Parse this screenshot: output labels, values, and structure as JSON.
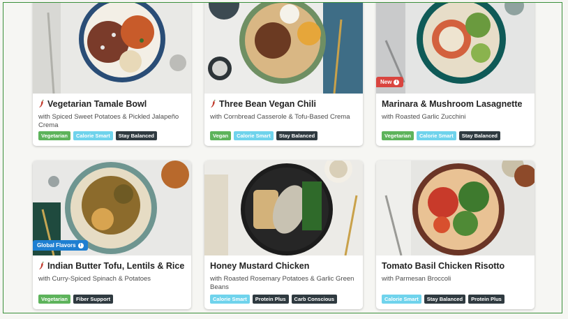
{
  "cards": [
    {
      "title": "Vegetarian Tamale Bowl",
      "subtitle": "with Spiced Sweet Potatoes & Pickled Jalapeño Crema",
      "spicy": true,
      "tags": [
        {
          "label": "Vegetarian",
          "kind": "veg"
        },
        {
          "label": "Calorie Smart",
          "kind": "cal"
        },
        {
          "label": "Stay Balanced",
          "kind": "dark"
        }
      ]
    },
    {
      "title": "Three Bean Vegan Chili",
      "subtitle": "with Cornbread Casserole & Tofu-Based Crema",
      "spicy": true,
      "tags": [
        {
          "label": "Vegan",
          "kind": "veg"
        },
        {
          "label": "Calorie Smart",
          "kind": "cal"
        },
        {
          "label": "Stay Balanced",
          "kind": "dark"
        }
      ]
    },
    {
      "title": "Marinara & Mushroom Lasagnette",
      "subtitle": "with Roasted Garlic Zucchini",
      "spicy": false,
      "badge": {
        "label": "New",
        "color": "#d9453f"
      },
      "tags": [
        {
          "label": "Vegetarian",
          "kind": "veg"
        },
        {
          "label": "Calorie Smart",
          "kind": "cal"
        },
        {
          "label": "Stay Balanced",
          "kind": "dark"
        }
      ]
    },
    {
      "title": "Indian Butter Tofu, Lentils & Rice",
      "subtitle": "with Curry-Spiced Spinach & Potatoes",
      "spicy": true,
      "badge": {
        "label": "Global Flavors",
        "color": "#1e7fd1"
      },
      "tags": [
        {
          "label": "Vegetarian",
          "kind": "veg"
        },
        {
          "label": "Fiber Support",
          "kind": "dark"
        }
      ]
    },
    {
      "title": "Honey Mustard Chicken",
      "subtitle": "with Roasted Rosemary Potatoes & Garlic Green Beans",
      "spicy": false,
      "tags": [
        {
          "label": "Calorie Smart",
          "kind": "cal"
        },
        {
          "label": "Protein Plus",
          "kind": "dark"
        },
        {
          "label": "Carb Conscious",
          "kind": "dark"
        }
      ]
    },
    {
      "title": "Tomato Basil Chicken Risotto",
      "subtitle": "with Parmesan Broccoli",
      "spicy": false,
      "tags": [
        {
          "label": "Calorie Smart",
          "kind": "cal"
        },
        {
          "label": "Stay Balanced",
          "kind": "dark"
        },
        {
          "label": "Protein Plus",
          "kind": "dark"
        }
      ]
    }
  ],
  "icons": {
    "spicy": "chili-pepper-icon",
    "badge_info": "info-icon"
  },
  "colors": {
    "vegetarian_tag": "#5db35b",
    "calorie_smart_tag": "#6fd3ec",
    "dark_tag": "#2f3a40",
    "new_badge": "#d9453f",
    "global_badge": "#1e7fd1",
    "spicy": "#c0392b"
  }
}
